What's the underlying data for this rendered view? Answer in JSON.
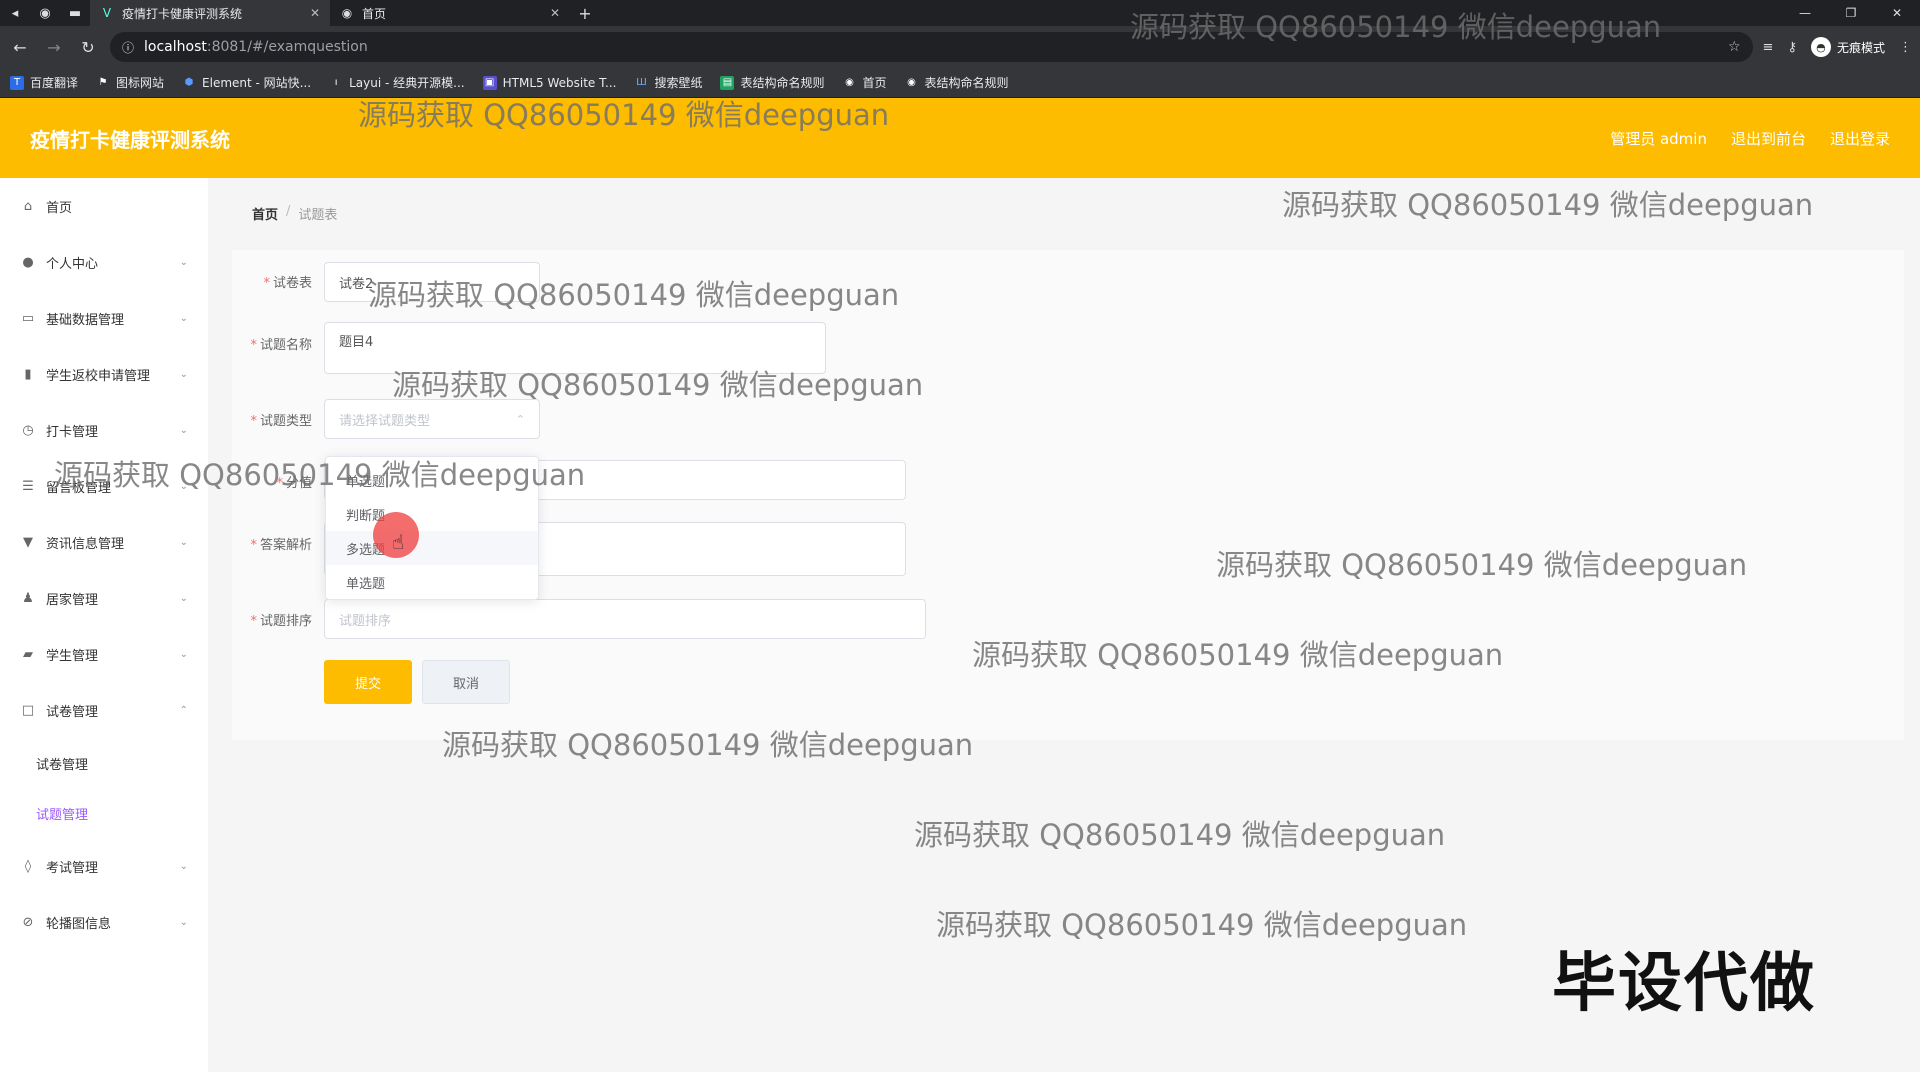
{
  "browser": {
    "tabs": [
      {
        "label": "疫情打卡健康评测系统",
        "active": true
      },
      {
        "label": "首页",
        "active": false
      }
    ],
    "url_host": "localhost",
    "url_rest": ":8081/#/examquestion",
    "incognito_label": "无痕模式",
    "bookmarks": [
      "百度翻译",
      "图标网站",
      "Element - 网站快...",
      "Layui - 经典开源模...",
      "HTML5 Website T...",
      "搜索壁纸",
      "表结构命名规则",
      "首页",
      "表结构命名规则"
    ]
  },
  "header": {
    "title": "疫情打卡健康评测系统",
    "admin": "管理员 admin",
    "to_front": "退出到前台",
    "logout": "退出登录"
  },
  "sidebar": {
    "items": [
      {
        "label": "首页",
        "icon": "home-icon"
      },
      {
        "label": "个人中心",
        "icon": "user-icon"
      },
      {
        "label": "基础数据管理",
        "icon": "card-icon"
      },
      {
        "label": "学生返校申请管理",
        "icon": "bar-chart-icon"
      },
      {
        "label": "打卡管理",
        "icon": "clock-icon"
      },
      {
        "label": "留言板管理",
        "icon": "list-icon"
      },
      {
        "label": "资讯信息管理",
        "icon": "phone-icon"
      },
      {
        "label": "居家管理",
        "icon": "person-icon"
      },
      {
        "label": "学生管理",
        "icon": "student-icon"
      },
      {
        "label": "试卷管理",
        "icon": "paper-icon"
      },
      {
        "label": "考试管理",
        "icon": "mic-icon"
      },
      {
        "label": "轮播图信息",
        "icon": "image-icon"
      }
    ],
    "submenu": [
      {
        "label": "试卷管理"
      },
      {
        "label": "试题管理"
      }
    ]
  },
  "breadcrumb": {
    "home": "首页",
    "current": "试题表"
  },
  "form": {
    "paper_label": "试卷表",
    "paper_value": "试卷2",
    "name_label": "试题名称",
    "name_value": "题目4",
    "type_label": "试题类型",
    "type_placeholder": "请选择试题类型",
    "score_label": "分值",
    "analysis_label": "答案解析",
    "sort_label": "试题排序",
    "sort_placeholder": "试题排序",
    "submit": "提交",
    "cancel": "取消"
  },
  "dropdown": {
    "options": [
      "单选题",
      "判断题",
      "多选题",
      "单选题"
    ]
  },
  "overlays": {
    "watermark": "源码获取 QQ86050149 微信deepguan",
    "badge": "毕设代做"
  }
}
